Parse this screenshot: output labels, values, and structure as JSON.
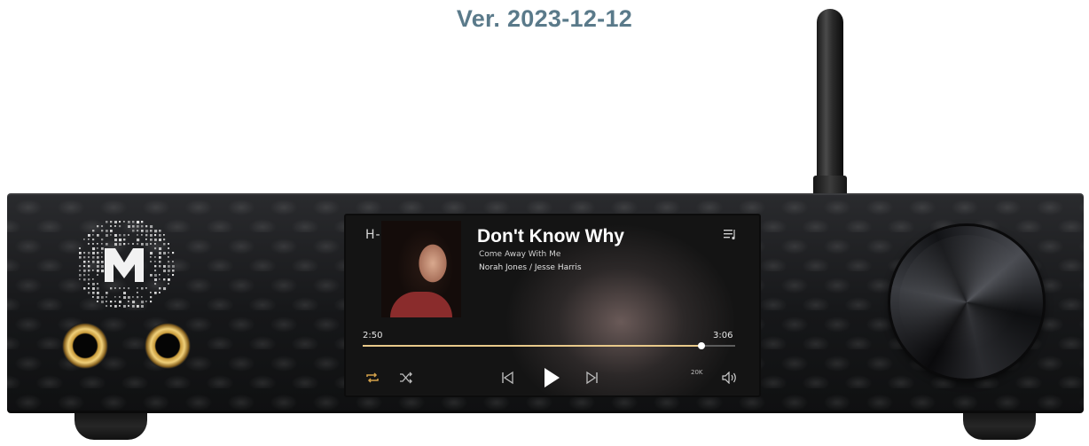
{
  "version_label": "Ver. 2023-12-12",
  "player": {
    "brand_mark": "H-K",
    "track": {
      "title": "Don't Know Why",
      "album": "Come Away With Me",
      "artists": "Norah Jones / Jesse Harris"
    },
    "progress": {
      "elapsed": "2:50",
      "total": "3:06",
      "fraction": 0.91
    },
    "volume_label": "20K",
    "controls": {
      "repeat": "repeat-icon",
      "shuffle": "shuffle-icon",
      "previous": "previous-icon",
      "play": "play-icon",
      "next": "next-icon",
      "volume": "volume-icon",
      "queue": "queue-icon"
    }
  },
  "colors": {
    "accent": "#e8c98a",
    "repeat_icon": "#d4a24a",
    "jack_gold": "#c89a3a",
    "version_text": "#5a7a8a"
  }
}
